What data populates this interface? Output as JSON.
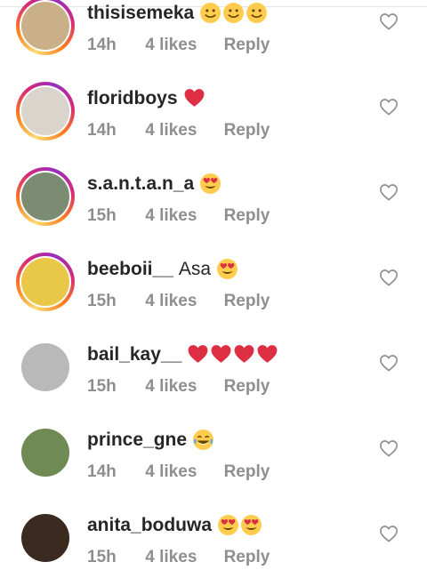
{
  "comments": [
    {
      "username": "thisisemeka",
      "text": "",
      "emoji": [
        "smile",
        "smile",
        "smile"
      ],
      "time": "14h",
      "likes": "4 likes",
      "reply": "Reply",
      "story": true,
      "avatar_bg": "#c9b089"
    },
    {
      "username": "floridboys",
      "text": "",
      "emoji": [
        "red-heart"
      ],
      "time": "14h",
      "likes": "4 likes",
      "reply": "Reply",
      "story": true,
      "avatar_bg": "#d9d4cc"
    },
    {
      "username": "s.a.n.t.a.n_a",
      "text": "",
      "emoji": [
        "heart-eyes"
      ],
      "time": "15h",
      "likes": "4 likes",
      "reply": "Reply",
      "story": true,
      "avatar_bg": "#7c8c73"
    },
    {
      "username": "beeboii__",
      "text": "Asa",
      "emoji": [
        "heart-eyes"
      ],
      "time": "15h",
      "likes": "4 likes",
      "reply": "Reply",
      "story": true,
      "avatar_bg": "#e9c847"
    },
    {
      "username": "bail_kay__",
      "text": "",
      "emoji": [
        "red-heart",
        "red-heart",
        "red-heart",
        "red-heart"
      ],
      "time": "15h",
      "likes": "4 likes",
      "reply": "Reply",
      "story": false,
      "avatar_bg": "#b9b9b9"
    },
    {
      "username": "prince_gne",
      "text": "",
      "emoji": [
        "tears-of-joy"
      ],
      "time": "14h",
      "likes": "4 likes",
      "reply": "Reply",
      "story": false,
      "avatar_bg": "#6f8a55"
    },
    {
      "username": "anita_boduwa",
      "text": "",
      "emoji": [
        "heart-eyes",
        "heart-eyes"
      ],
      "time": "15h",
      "likes": "4 likes",
      "reply": "Reply",
      "story": false,
      "avatar_bg": "#3a2a20"
    }
  ],
  "colors": {
    "meta": "#8e8e8e",
    "text": "#262626",
    "heart": "#e0245e"
  }
}
